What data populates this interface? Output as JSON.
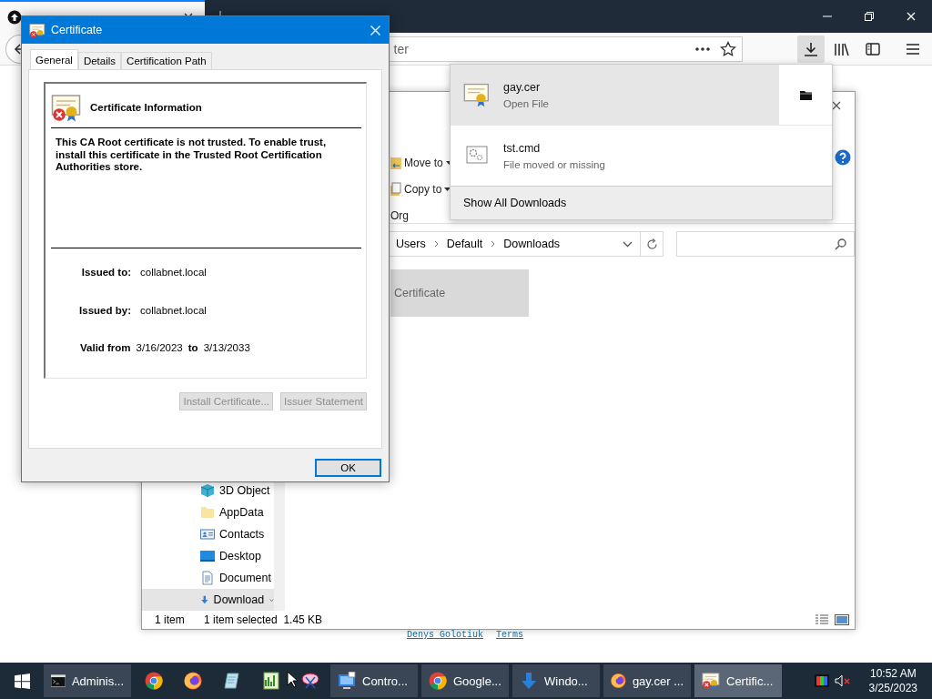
{
  "browser": {
    "address_fragment": "ter",
    "footer_links": [
      "Denys Golotiuk",
      "Terms"
    ]
  },
  "explorer": {
    "ribbon": [
      "Move to",
      "Copy to",
      "Org"
    ],
    "breadcrumb": [
      "Users",
      "Default",
      "Downloads"
    ],
    "files": [
      {
        "name": "Certificate",
        "selected": true
      }
    ],
    "nav_items": [
      {
        "label": "3D Object",
        "kind": "objects",
        "selected": false
      },
      {
        "label": "AppData",
        "kind": "folder",
        "selected": false
      },
      {
        "label": "Contacts",
        "kind": "contacts",
        "selected": false
      },
      {
        "label": "Desktop",
        "kind": "desktop",
        "selected": false
      },
      {
        "label": "Document",
        "kind": "document",
        "selected": false
      },
      {
        "label": "Download",
        "kind": "download",
        "selected": true
      }
    ],
    "status": {
      "count": "1 item",
      "selection": "1 item selected  1.45 KB"
    }
  },
  "downloads_panel": {
    "items": [
      {
        "name": "gay.cer",
        "status": "Open File",
        "kind": "certificate",
        "selected": true
      },
      {
        "name": "tst.cmd",
        "status": "File moved or missing",
        "kind": "script",
        "selected": false
      }
    ],
    "footer": "Show All Downloads"
  },
  "dialog": {
    "title": "Certificate",
    "tabs": [
      {
        "label": "General",
        "selected": true
      },
      {
        "label": "Details",
        "selected": false
      },
      {
        "label": "Certification Path",
        "selected": false
      }
    ],
    "heading": "Certificate Information",
    "message": "This CA Root certificate is not trusted. To enable trust, install this certificate in the Trusted Root Certification Authorities store.",
    "fields": [
      {
        "label": "Issued to:",
        "value": "collabnet.local"
      },
      {
        "label": "Issued by:",
        "value": "collabnet.local"
      }
    ],
    "validity": {
      "label": "Valid from",
      "from": "3/16/2023",
      "joiner": "to",
      "to": "3/13/2033"
    },
    "buttons": [
      {
        "label": "Install Certificate...",
        "disabled": true
      },
      {
        "label": "Issuer Statement",
        "disabled": true
      }
    ],
    "ok": "OK"
  },
  "taskbar": {
    "items": [
      {
        "kind": "cmd",
        "label": "Adminis...",
        "selected": false
      },
      {
        "kind": "chrome",
        "selected": false
      },
      {
        "kind": "firefox",
        "selected": false
      },
      {
        "kind": "notepad",
        "selected": false
      },
      {
        "kind": "monitor",
        "selected": false
      },
      {
        "kind": "snip",
        "selected": false
      },
      {
        "kind": "control",
        "label": "Contro...",
        "selected": false
      },
      {
        "kind": "chrome",
        "label": "Google...",
        "selected": false
      },
      {
        "kind": "download",
        "label": "Windo...",
        "selected": false
      },
      {
        "kind": "firefox",
        "label": "gay.cer ...",
        "selected": false
      },
      {
        "kind": "certificate",
        "label": "Certific...",
        "selected": true
      }
    ],
    "clock": {
      "time": "10:52 AM",
      "date": "3/25/2023"
    }
  }
}
